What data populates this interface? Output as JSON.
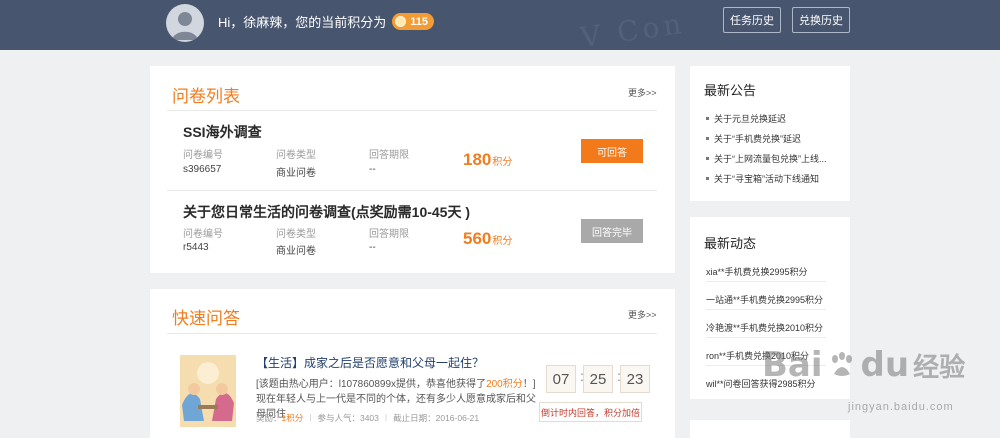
{
  "header": {
    "greeting": "Hi，徐麻辣，您的当前积分为",
    "points": "115",
    "task_history": "任务历史",
    "exchange_history": "兑换历史",
    "deco_text": "V Con"
  },
  "survey_list": {
    "title": "问卷列表",
    "more": "更多>>",
    "items": [
      {
        "title": "SSI海外调查",
        "id_label": "问卷编号",
        "id": "s396657",
        "type_label": "问卷类型",
        "type": "商业问卷",
        "period_label": "回答期限",
        "period": "--",
        "score": "180",
        "unit": "积分",
        "button": "可回答"
      },
      {
        "title": "关于您日常生活的问卷调查(点奖励需10-45天 )",
        "id_label": "问卷编号",
        "id": "r5443",
        "type_label": "问卷类型",
        "type": "商业问卷",
        "period_label": "回答期限",
        "period": "--",
        "score": "560",
        "unit": "积分",
        "button": "回答完毕"
      }
    ]
  },
  "quick_answer": {
    "title": "快速问答",
    "more": "更多>>",
    "item": {
      "title": "【生活】成家之后是否愿意和父母一起住？",
      "desc_pre": "[该题由热心用户：l107860899x提供，恭喜他获得了",
      "desc_hl": "200积分",
      "desc_post": "！]现在年轻人与上一代是不同的个体，还有多少人愿意成家后和父母同住",
      "reward_label": "奖励：",
      "reward": "1积分",
      "popularity": "参与人气：3403",
      "deadline": "截止日期：2016-06-21",
      "countdown": [
        "07",
        "25",
        "23"
      ],
      "countdown_note": "倒计时内回答，积分加倍"
    }
  },
  "announcements": {
    "title": "最新公告",
    "items": [
      "关于元旦兑换延迟",
      "关于“手机费兑换”延迟",
      "关于“上网流量包兑换”上线...",
      "关于“寻宝箱”活动下线通知"
    ]
  },
  "activity": {
    "title": "最新动态",
    "items": [
      "xia**手机费兑换2995积分",
      "一站通**手机费兑换2995积分",
      "冷艳渡**手机费兑换2010积分",
      "ron**手机费兑换2010积分",
      "wil**问卷回答获得2985积分"
    ]
  },
  "watermark": {
    "brand_a": "Bai",
    "brand_b": "du",
    "brand_c": "经验",
    "url": "jingyan.baidu.com"
  },
  "colors": {
    "header_bg": "#47556e",
    "accent": "#f07d1f",
    "button_orange": "#f27a1a",
    "button_grey": "#a9a9a9"
  }
}
